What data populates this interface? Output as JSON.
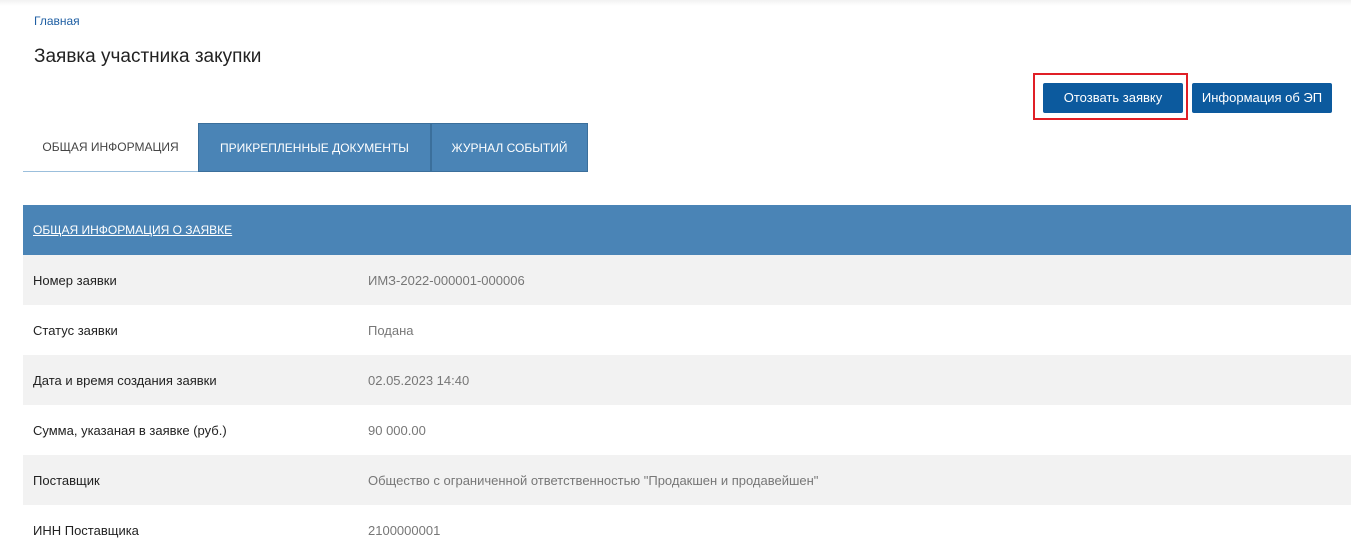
{
  "breadcrumb": {
    "home": "Главная"
  },
  "page": {
    "title": "Заявка участника закупки"
  },
  "actions": {
    "withdraw_label": "Отозвать заявку",
    "signature_info_label": "Информация об ЭП"
  },
  "tabs": [
    {
      "label": "ОБЩАЯ ИНФОРМАЦИЯ",
      "active": true
    },
    {
      "label": "ПРИКРЕПЛЕННЫЕ ДОКУМЕНТЫ",
      "active": false
    },
    {
      "label": "ЖУРНАЛ СОБЫТИЙ",
      "active": false
    }
  ],
  "section": {
    "title": "ОБЩАЯ ИНФОРМАЦИЯ О ЗАЯВКЕ"
  },
  "fields": [
    {
      "label": "Номер заявки",
      "value": "ИМЗ-2022-000001-000006"
    },
    {
      "label": "Статус заявки",
      "value": "Подана"
    },
    {
      "label": "Дата и время создания заявки",
      "value": "02.05.2023 14:40"
    },
    {
      "label": "Сумма, указаная в заявке (руб.)",
      "value": "90 000.00"
    },
    {
      "label": "Поставщик",
      "value": "Общество с ограниченной ответственностью \"Продакшен и продавейшен\""
    },
    {
      "label": "ИНН Поставщика",
      "value": "2100000001"
    }
  ],
  "colors": {
    "accent": "#0c5a9e",
    "header_blue": "#4a84b6",
    "highlight_red": "#e01f26",
    "link": "#1f5fa3"
  }
}
